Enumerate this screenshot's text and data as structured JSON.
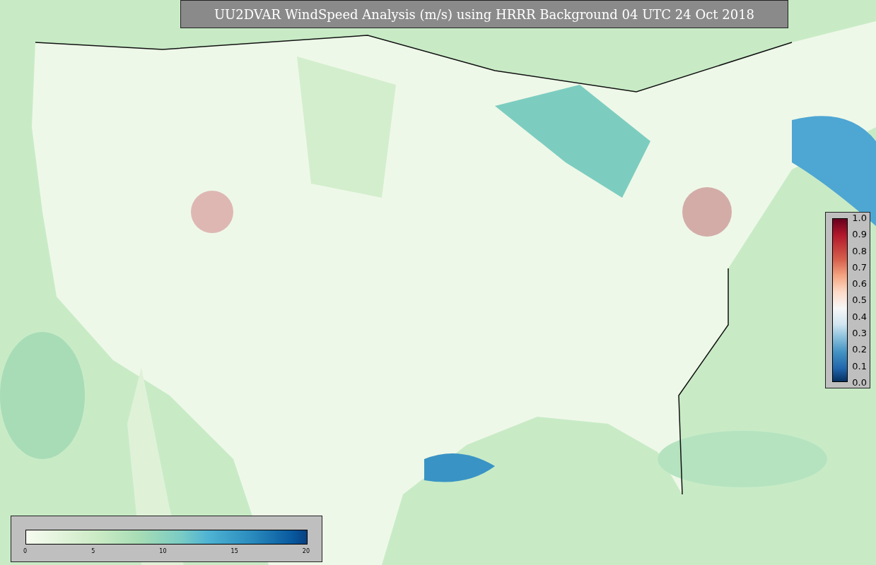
{
  "title": "UU2DVAR WindSpeed Analysis (m/s) using HRRR Background 04 UTC 24 Oct 2018",
  "right_colorbar": {
    "ticks": [
      "1.0",
      "0.9",
      "0.8",
      "0.7",
      "0.6",
      "0.5",
      "0.4",
      "0.3",
      "0.2",
      "0.1",
      "0.0"
    ]
  },
  "bottom_colorbar": {
    "ticks": [
      "0",
      "5",
      "10",
      "15",
      "20"
    ]
  }
}
